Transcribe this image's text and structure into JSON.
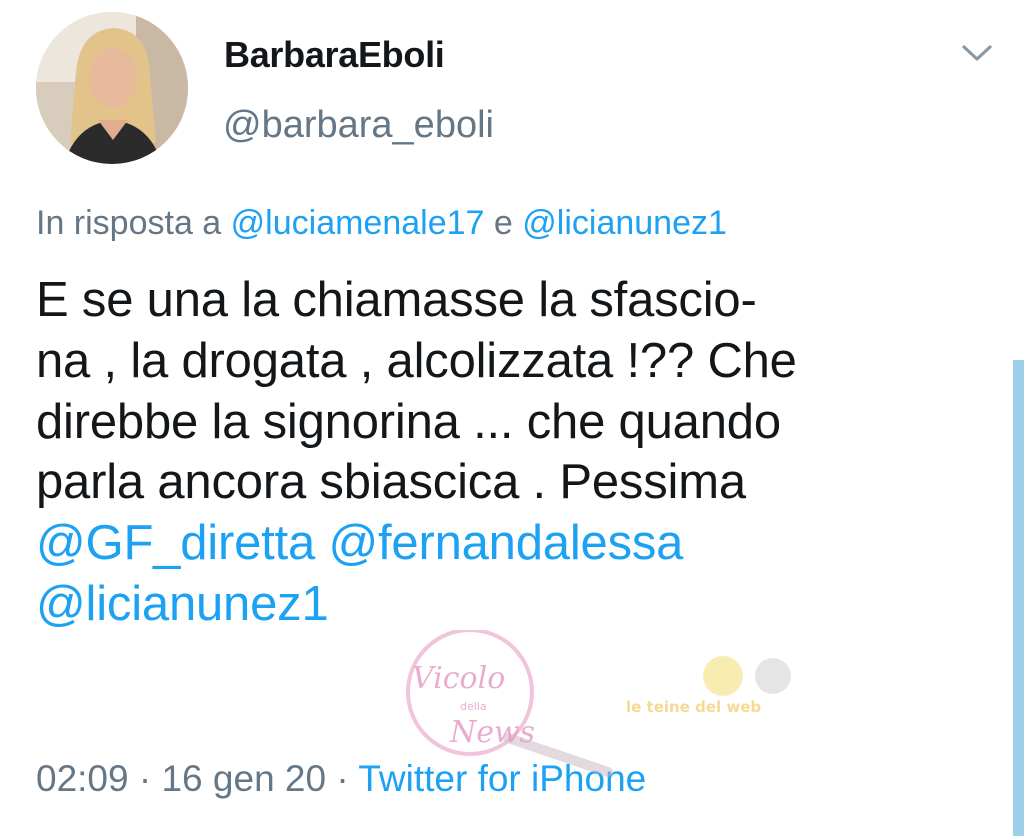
{
  "tweet": {
    "display_name": "BarbaraEboli",
    "handle": "@barbara_eboli",
    "reply": {
      "prefix": "In risposta a",
      "mention1": "@luciamenale17",
      "joiner": "e",
      "mention2": "@licianunez1"
    },
    "text_lines": [
      "E se una la chiamasse la sfascio-",
      "na , la drogata , alcolizzata !?? Che",
      "direbbe la signorina ... che quando",
      "parla ancora sbiascica . Pessima"
    ],
    "text_mentions": {
      "line5_a": "@GF_diretta",
      "line5_b": "@fernandalessa",
      "line6": "@licianunez1"
    },
    "meta": {
      "time": "02:09",
      "separator": "·",
      "date": "16 gen 20",
      "source": "Twitter for iPhone"
    }
  },
  "watermark": {
    "text_main": "Vicolo",
    "text_small": "della",
    "text_news": "News",
    "text_right": "le teine del web"
  },
  "colors": {
    "link": "#1da1f2",
    "secondary": "#657786",
    "text": "#14171a",
    "scrollbar": "#9ccfe9"
  },
  "icons": {
    "caret": "chevron-down-icon",
    "avatar": "profile-photo"
  }
}
